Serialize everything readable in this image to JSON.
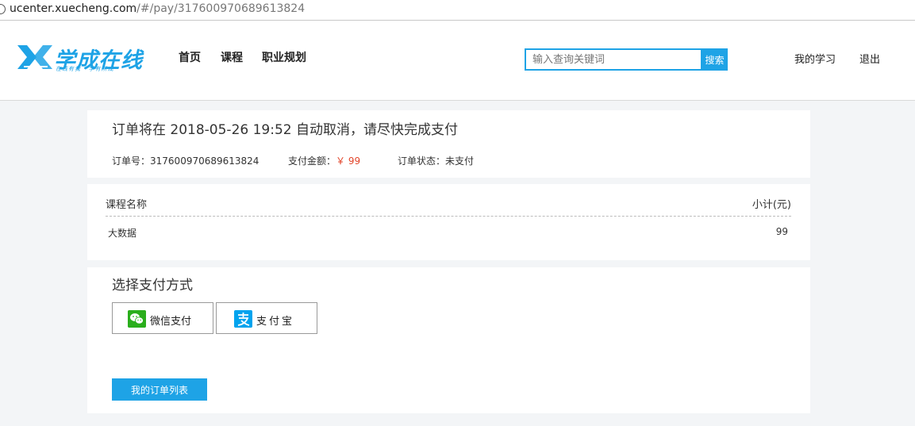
{
  "browser": {
    "url_host": "ucenter.xuecheng.com",
    "url_rest": "/#/pay/317600970689613824"
  },
  "header": {
    "logo_text": "学成在线",
    "logo_slogan": "在线有我 · 学有所成",
    "nav": [
      "首页",
      "课程",
      "职业规划"
    ],
    "search_placeholder": "输入查询关键词",
    "search_button": "搜索",
    "my_learning": "我的学习",
    "logout": "退出",
    "accent_color": "#1ea3e6"
  },
  "order": {
    "deadline_text": "订单将在 2018-05-26 19:52 自动取消，请尽快完成支付",
    "order_no_label": "订单号：",
    "order_no": "317600970689613824",
    "amount_label": "支付金额：",
    "amount": "￥ 99",
    "status_label": "订单状态：",
    "status": "未支付",
    "price_color": "#e2452a"
  },
  "course_table": {
    "headers": [
      "课程名称",
      "小计(元)"
    ],
    "rows": [
      {
        "name": "大数据",
        "subtotal": "99"
      }
    ]
  },
  "payment": {
    "title": "选择支付方式",
    "methods": [
      {
        "label": "微信支付",
        "icon": "wechat-icon"
      },
      {
        "label": "支付宝",
        "icon": "alipay-icon"
      }
    ],
    "orders_button": "我的订单列表"
  }
}
